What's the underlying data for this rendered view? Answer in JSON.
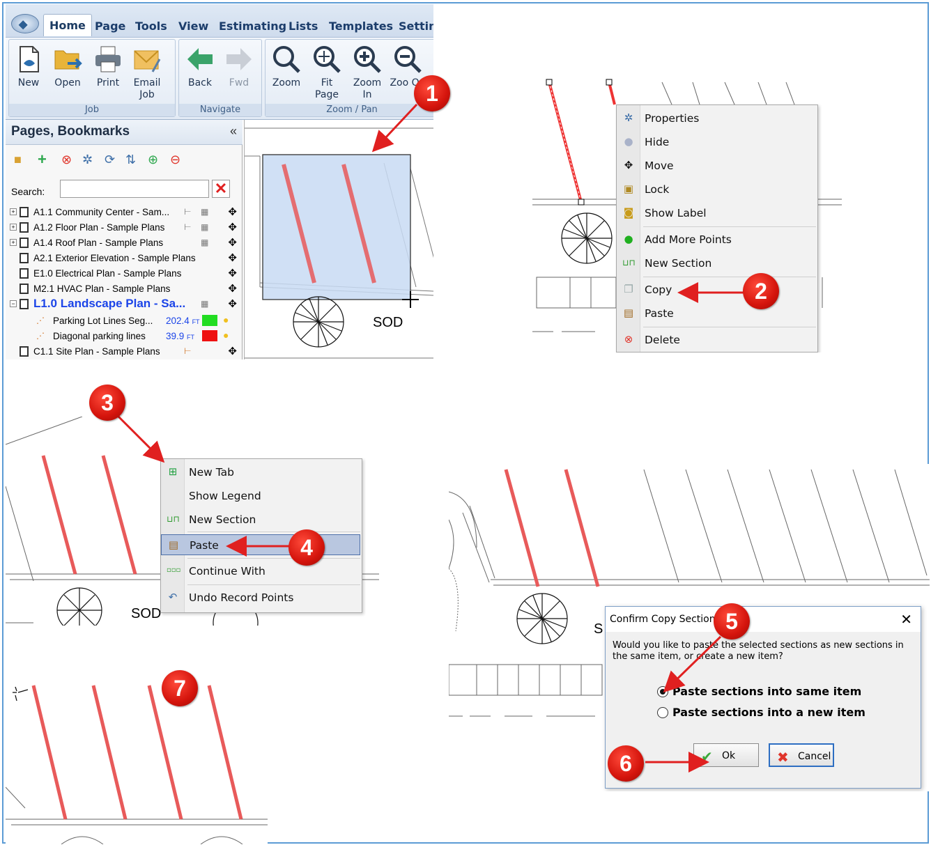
{
  "ribbon": {
    "tabs": [
      "Home",
      "Page",
      "Tools",
      "View",
      "Estimating",
      "Lists",
      "Templates",
      "Setting"
    ],
    "groups": {
      "job": "Job",
      "navigate": "Navigate",
      "zoom_pan": "Zoom / Pan"
    },
    "buttons": {
      "new": "New",
      "open": "Open",
      "print": "Print",
      "email_job": "Email Job",
      "back": "Back",
      "fwd": "Fwd",
      "zoom": "Zoom",
      "fit_page": "Fit Page",
      "zoom_in": "Zoom In",
      "zoom_out": "Zoo Ou"
    }
  },
  "pages_panel": {
    "title": "Pages, Bookmarks",
    "collapse": "«",
    "search_label": "Search:",
    "search_value": "",
    "pages": [
      {
        "label": "A1.1 Community Center - Sam...",
        "expand": "+"
      },
      {
        "label": "A1.2 Floor Plan - Sample Plans",
        "expand": "+"
      },
      {
        "label": "A1.4 Roof Plan - Sample Plans",
        "expand": "+"
      },
      {
        "label": "A2.1 Exterior Elevation - Sample Plans"
      },
      {
        "label": "E1.0 Electrical Plan - Sample Plans"
      },
      {
        "label": "M2.1 HVAC Plan - Sample Plans"
      },
      {
        "label": "L1.0 Landscape Plan - Sa...",
        "expand": "−"
      },
      {
        "label": "C1.1 Site Plan - Sample Plans"
      }
    ],
    "conditions": [
      {
        "label": "Parking Lot Lines Seg...",
        "qty": "202.4",
        "unit": "FT",
        "color": "#22dd22"
      },
      {
        "label": "Diagonal parking lines",
        "qty": "39.9",
        "unit": "FT",
        "color": "#ee1111"
      }
    ]
  },
  "canvas_labels": {
    "sod1": "SOD",
    "sod3": "SOD",
    "s4": "S"
  },
  "context_menu_1": {
    "items": [
      "Properties",
      "Hide",
      "Move",
      "Lock",
      "Show Label",
      "Add More Points",
      "New Section",
      "Copy",
      "Paste",
      "Delete"
    ]
  },
  "context_menu_2": {
    "items": [
      "New Tab",
      "Show Legend",
      "New Section",
      "Paste",
      "Continue With",
      "Undo Record Points"
    ]
  },
  "dialog": {
    "title": "Confirm Copy Section",
    "message": "Would you like to paste the selected sections as new sections in the same item, or create a new item?",
    "option_same": "Paste sections into same item",
    "option_new": "Paste sections into a new item",
    "ok": "Ok",
    "cancel": "Cancel"
  },
  "steps": [
    "1",
    "2",
    "3",
    "4",
    "5",
    "6",
    "7"
  ],
  "colors": {
    "frame": "#5b9bd5",
    "callout": "#e02020",
    "selection": "#c8dbf3",
    "line": "#e85a5a"
  }
}
